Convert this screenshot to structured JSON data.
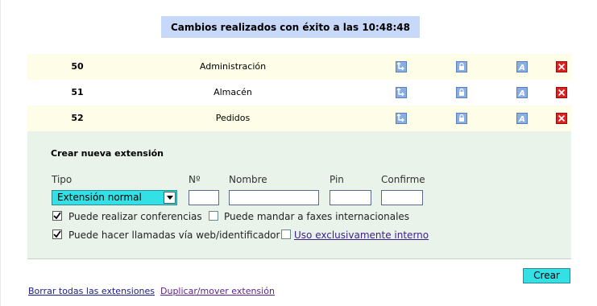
{
  "banner": {
    "message": "Cambios realizados con éxito a las 10:48:48"
  },
  "extensions": [
    {
      "number": "50",
      "name": "Administración"
    },
    {
      "number": "51",
      "name": "Almacén"
    },
    {
      "number": "52",
      "name": "Pedidos"
    }
  ],
  "row_icons": [
    "transfer-icon",
    "lock-icon",
    "letter-a-icon",
    "delete-icon"
  ],
  "create": {
    "title": "Crear nueva extensión",
    "labels": {
      "tipo": "Tipo",
      "numero": "Nº",
      "nombre": "Nombre",
      "pin": "Pin",
      "confirme": "Confirme"
    },
    "values": {
      "numero": "",
      "nombre": "",
      "pin": "",
      "confirme": ""
    },
    "tipo_selected": "Extensión normal",
    "checkboxes": {
      "conferencias": {
        "label": "Puede realizar conferencias",
        "checked": true
      },
      "faxes": {
        "label": "Puede mandar a faxes internacionales",
        "checked": false
      },
      "llamadas_web": {
        "label": "Puede hacer llamadas vía web/identificador",
        "checked": true
      },
      "interno": {
        "label": "Uso exclusivamente interno",
        "checked": false
      }
    },
    "submit_label": "Crear"
  },
  "footer": {
    "borrar": "Borrar todas las extensiones",
    "duplicar": "Duplicar/mover extensión"
  },
  "colors": {
    "banner_bg": "#c8d8f8",
    "row_shade": "#fdfde8",
    "panel_bg": "#eaf3ea",
    "accent_cyan": "#33e0e6",
    "delete_red": "#e02020"
  }
}
